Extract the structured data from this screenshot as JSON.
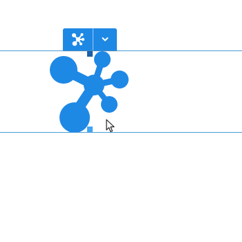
{
  "colors": {
    "accent": "#1e88e5",
    "shape_fill": "#1e88e5",
    "guide_line": "#4a9bd6",
    "handle_top": "#1a5fa8",
    "handle_bottom": "#42a5f5"
  },
  "toolbar": {
    "shape_button_icon": "molecule-shape-icon",
    "dropdown_icon": "chevron-down-icon"
  },
  "canvas": {
    "selected_shape_icon": "molecule-shape-icon"
  },
  "cursor": {
    "icon": "mouse-pointer-icon"
  }
}
